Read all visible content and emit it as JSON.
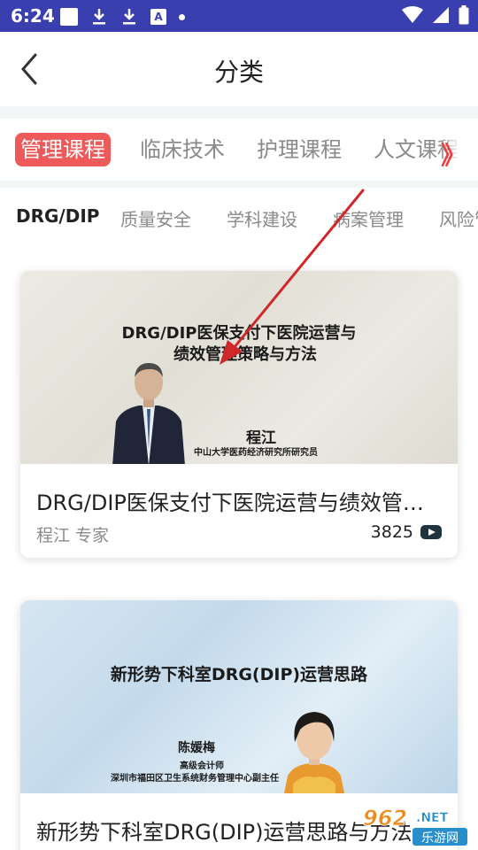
{
  "status_bar": {
    "time": "6:24",
    "notif_a": "A"
  },
  "header": {
    "title": "分类"
  },
  "categories": [
    "管理课程",
    "临床技术",
    "护理课程",
    "人文课程"
  ],
  "categories_more": "》",
  "subcategories": [
    "DRG/DIP",
    "质量安全",
    "学科建设",
    "病案管理",
    "风险管理"
  ],
  "courses": [
    {
      "thumb_title_line1": "DRG/DIP医保支付下医院运营与",
      "thumb_title_line2": "绩效管理策略与方法",
      "thumb_name": "程江",
      "thumb_affil": "中山大学医药经济研究所研究员",
      "title": "DRG/DIP医保支付下医院运营与绩效管理策略与方法",
      "author": "程江 专家",
      "views": "3825"
    },
    {
      "thumb_title_line1": "新形势下科室DRG(DIP)运营思路",
      "thumb_name": "陈媛梅",
      "thumb_role": "高级会计师",
      "thumb_affil": "深圳市福田区卫生系统财务管理中心副主任",
      "title": "新形势下科室DRG(DIP)运营思路与方法",
      "author": "",
      "views": ""
    }
  ],
  "watermark": {
    "number": "962",
    "suffix": ".NET",
    "text": "乐游网"
  },
  "colors": {
    "status_bar": "#3a3fb0",
    "accent_red": "#ee5a5a",
    "separator": "#f3f6f6",
    "arrow": "#d0282a"
  }
}
